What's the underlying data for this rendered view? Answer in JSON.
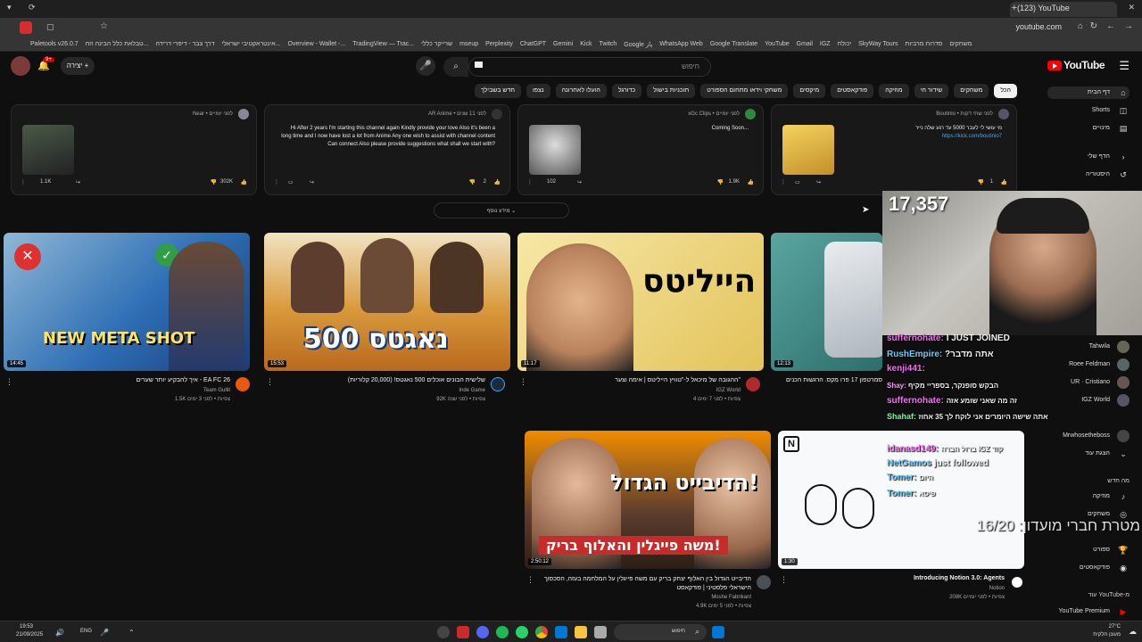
{
  "browser": {
    "tab_title": "(123) YouTube",
    "url": "youtube.com",
    "bookmarks": [
      "Paletools v26.0.7",
      "טבלאת כלל הבינה הח...",
      "דרך צבר - דיפרי דרידה",
      "אינטראקטיבי ישראלי...",
      "Overview - Wallet -...",
      "TradingView — Trac...",
      "שרייקר כללי",
      "mseup",
      "Perplexity",
      "ChatGPT",
      "Gemini",
      "Kick",
      "Twitch",
      "Google پاز",
      "WhatsApp Web",
      "Google Translate",
      "YouTube",
      "Gmail",
      "IGZ",
      "יכולת",
      "SkyWay Tours",
      "סדרות מרביות",
      "משחקים"
    ]
  },
  "header": {
    "search_placeholder": "חיפוש",
    "create_label": "יצירה",
    "logo_text": "YouTube",
    "notification_count": "9+"
  },
  "chips": [
    "הכל",
    "משחקים",
    "שידור חי",
    "מוזיקה",
    "פודקאסטים",
    "מיקסים",
    "משחקי וידאו מתחום הספורט",
    "תוכניות בישול",
    "כדורגל",
    "הועלו לאחרונה",
    "נצפו",
    "חדש בשבילך"
  ],
  "sidebar": {
    "items": [
      {
        "label": "דף הבית",
        "icon": "⌂"
      },
      {
        "label": "Shorts",
        "icon": "◫"
      },
      {
        "label": "מינויים",
        "icon": "▤"
      }
    ],
    "you_title": "הדף שלי",
    "history_label": "היסטוריה",
    "subs": [
      "Tahwila",
      "Roee Feldman",
      "UR · Cristiano",
      "IGZ World",
      "Mrwhosetheboss"
    ],
    "show_more_subs": "הצגת עוד",
    "explore_title": "מה חדש",
    "explore": [
      "מוזיקה",
      "משחקים",
      "ספורט",
      "פודקאסטים"
    ],
    "more_from": "עוד YouTube-מ",
    "premium": "YouTube Premium"
  },
  "posts": [
    {
      "author": "Boutinio • לפני שתי דקות",
      "text": "מי עושי לי לעבר 5000 עד רגע שלה נייר",
      "link": "https://kick.com/boutinio7",
      "likes": "1"
    },
    {
      "author": "xGc Clips • לפני יומיים",
      "text": "Coming Soon...",
      "likes": "1.9K",
      "comments": "102"
    },
    {
      "author": "AR Anime • לפני 11 שנים",
      "text": "Hi After 2 years I'm starting this channel again Kindly provide your love Also it's been a long time and I now have lost a lot from Anime Any one wish to assist with channel content Can connect Also please provide suggestions what shall we start with?",
      "likes": "2"
    },
    {
      "author": "Near • לפני יומיים",
      "text": "",
      "likes": "302K",
      "comments": "1.1K"
    }
  ],
  "show_more": "מידע נוסף",
  "videos_row1": [
    {
      "title": "איך להבקיע יותר שערים - EA FC 26",
      "channel": "Team Gullit",
      "meta": "1.5K צפיות • לפני 3 ימים",
      "duration": "14:45",
      "thumb_text": "NEW META SHOT"
    },
    {
      "title": "שלישית הבונים אוכלים 500 נאגטס! (20,000 קלוריות)",
      "channel": "Inde Game",
      "meta": "92K צפיות • לפני שנה",
      "duration": "15:53",
      "thumb_text": "500 נאגטס"
    },
    {
      "title": "ההגובה של מיכאל ל-\"טוויץ הייליטס | אימה וצער\"",
      "channel": "IGZ World",
      "meta": "4 צפיות • לפני 7 ימים",
      "duration": "11:17",
      "thumb_text": "טוויץ הייליטס"
    },
    {
      "title": "סמרטפון 17 פרו מקס. הרגשות הכנים",
      "channel": "",
      "meta": "",
      "duration": "12:13",
      "thumb_text": ""
    }
  ],
  "videos_row2": [
    {
      "title": "הדיבייט הגדול בין האלוף יצחק בריק עם משה פייגלין על המלחמה בעזה, הסכסוך הישראלי פלסטיני | פודקאסט",
      "channel": "Moshe Fabrikant",
      "meta": "4.9K צפיות • לפני 5 ימים",
      "duration": "2:50:12",
      "thumb_text": "הדיבייט הגדול!",
      "thumb_sub": "משה פייגלין והאלוף בריק!"
    },
    {
      "title": "Introducing Notion 3.0: Agents",
      "channel": "Notion",
      "meta": "208K צפיות • לפני יומיים",
      "duration": "1:30"
    }
  ],
  "stream": {
    "viewer_count": "17,357",
    "overlay_text": "מטרת חברי מועדון: 16/20",
    "chat": [
      {
        "user": "suffernohate:",
        "msg": "I JUST JOINED",
        "color": "#ff66ff"
      },
      {
        "user": "RushEmpire:",
        "msg": "?אתה מדבר",
        "color": "#66ccff"
      },
      {
        "user": "kenji441:",
        "msg": "",
        "color": "#ff66ff"
      },
      {
        "user": "Shay:",
        "msg": "הבקש סופנקר, בספריי מקיף",
        "color": "#ff99ff"
      },
      {
        "user": "suffernohate:",
        "msg": "זה מה שאני שומע אזה",
        "color": "#ff66ff"
      },
      {
        "user": "Shahaf:",
        "msg": "אתה שישה היומרים אני לוקח לך 35 אחוז",
        "color": "#66ff99"
      },
      {
        "user": "idanasd149:",
        "msg": "ברול הברה IGZ קוד",
        "color": "#ff66ff"
      },
      {
        "user": "NetGamos",
        "msg": "just followed",
        "color": "#66ccff"
      },
      {
        "user": "Tomer:",
        "msg": "היום",
        "color": "#66ccff"
      },
      {
        "user": "Tomer:",
        "msg": "פיסא",
        "color": "#66ccff"
      }
    ]
  },
  "taskbar": {
    "time": "19:53",
    "date": "21/09/2025",
    "lang": "ENG",
    "search": "חיפוש",
    "weather": "27°C",
    "weather_desc": "מעונן חלקית"
  }
}
